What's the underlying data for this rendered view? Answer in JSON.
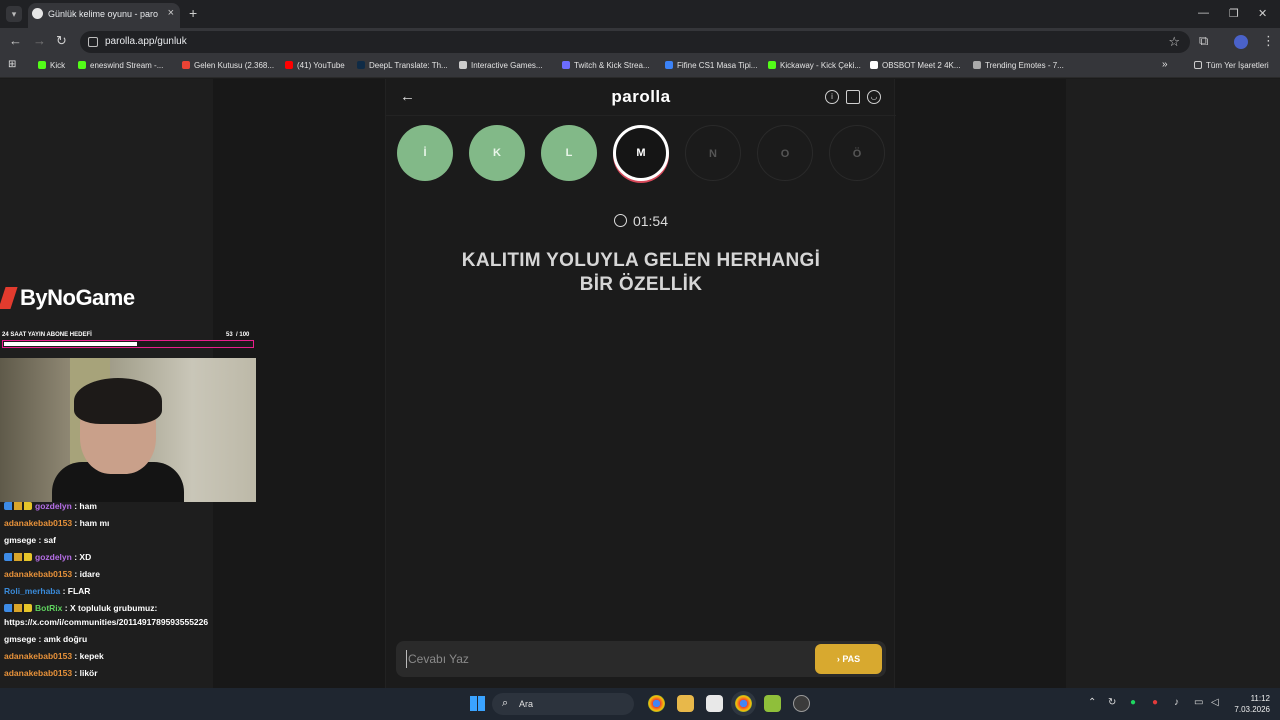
{
  "browser": {
    "tab_title": "Günlük kelime oyunu - parolla",
    "url": "parolla.app/gunluk",
    "bookmarks": [
      {
        "label": "Kick",
        "color": "#53fc18"
      },
      {
        "label": "eneswind Stream -...",
        "color": "#53fc18"
      },
      {
        "label": "Gelen Kutusu (2.368...",
        "color": "#ea4335"
      },
      {
        "label": "(41) YouTube",
        "color": "#ff0000"
      },
      {
        "label": "DeepL Translate: Th...",
        "color": "#0f2b46"
      },
      {
        "label": "Interactive Games...",
        "color": "#cccccc"
      },
      {
        "label": "Twitch & Kick Strea...",
        "color": "#6c6cff"
      },
      {
        "label": "Fifine CS1 Masa Tipi...",
        "color": "#3b82f6"
      },
      {
        "label": "Kickaway - Kick Çeki...",
        "color": "#53fc18"
      },
      {
        "label": "OBSBOT Meet 2 4K...",
        "color": "#ffffff"
      },
      {
        "label": "Trending Emotes - 7...",
        "color": "#aaaaaa"
      }
    ],
    "all_bookmarks": "Tüm Yer İşaretleri"
  },
  "game": {
    "title": "parolla",
    "letters": [
      {
        "char": "İ",
        "state": "done"
      },
      {
        "char": "K",
        "state": "done"
      },
      {
        "char": "L",
        "state": "done"
      },
      {
        "char": "M",
        "state": "active"
      },
      {
        "char": "N",
        "state": "pending"
      },
      {
        "char": "O",
        "state": "pending"
      },
      {
        "char": "Ö",
        "state": "pending"
      }
    ],
    "timer": "01:54",
    "question_line1": "KALITIM YOLUYLA GELEN HERHANGİ",
    "question_line2": "BİR ÖZELLİK",
    "answer_placeholder": "Cevabı Yaz",
    "pass_label": "PAS"
  },
  "overlay": {
    "logo_text": "ByNoGame",
    "goal_label": "24 SAAT YAYIN ABONE HEDEFİ",
    "goal_count": "53",
    "goal_total": "/ 100",
    "goal_progress": 0.53
  },
  "chat": {
    "messages": [
      {
        "badges": true,
        "user": "gozdelyn",
        "color": "purple",
        "text": "ham"
      },
      {
        "badges": false,
        "user": "adanakebab0153",
        "color": "orange",
        "text": "ham mı"
      },
      {
        "badges": false,
        "user": "gmsege",
        "color": "white",
        "text": "saf"
      },
      {
        "badges": true,
        "user": "gozdelyn",
        "color": "purple",
        "text": "XD"
      },
      {
        "badges": false,
        "user": "adanakebab0153",
        "color": "orange",
        "text": "idare"
      },
      {
        "badges": false,
        "user": "Roli_merhaba",
        "color": "blue",
        "text": "FLAR"
      },
      {
        "badges": true,
        "user": "BotRix",
        "color": "green",
        "text": "X topluluk grubumuz:"
      },
      {
        "badges": false,
        "user": "",
        "color": "white",
        "text": "https://x.com/i/communities/2011491789593555226"
      },
      {
        "badges": false,
        "user": "gmsege",
        "color": "white",
        "text": "amk doğru"
      },
      {
        "badges": false,
        "user": "adanakebab0153",
        "color": "orange",
        "text": "kepek"
      },
      {
        "badges": false,
        "user": "adanakebab0153",
        "color": "orange",
        "text": "likör"
      }
    ]
  },
  "taskbar": {
    "search_label": "Ara",
    "time": "11:12",
    "date": "7.03.2026"
  }
}
